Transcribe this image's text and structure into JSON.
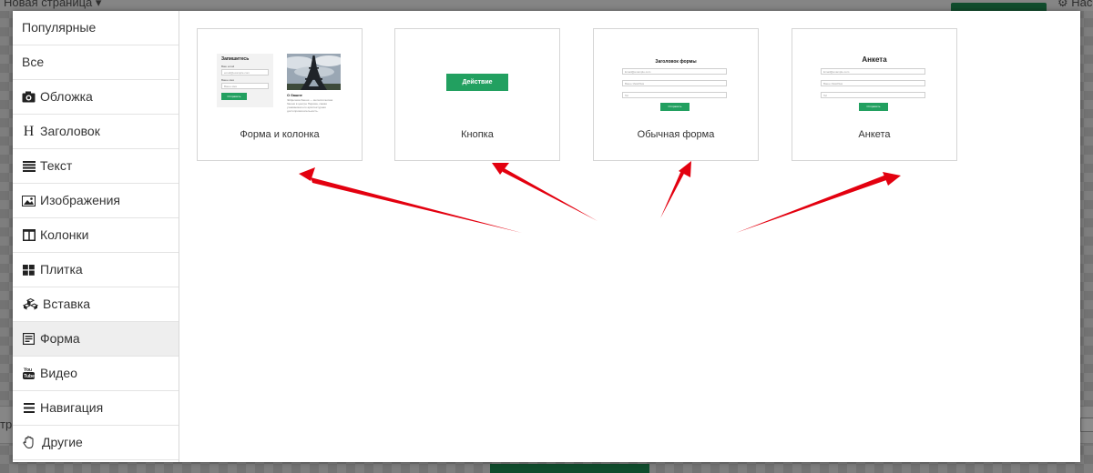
{
  "background": {
    "page_title": "Новая страница",
    "right_text": "Нас",
    "bottom_text": "тр"
  },
  "sidebar": {
    "items": [
      {
        "label": "Популярные",
        "icon": ""
      },
      {
        "label": "Все",
        "icon": ""
      },
      {
        "label": "Обложка",
        "icon": "camera-icon"
      },
      {
        "label": "Заголовок",
        "icon": "header-icon"
      },
      {
        "label": "Текст",
        "icon": "text-lines-icon"
      },
      {
        "label": "Изображения",
        "icon": "image-icon"
      },
      {
        "label": "Колонки",
        "icon": "columns-icon"
      },
      {
        "label": "Плитка",
        "icon": "tiles-icon"
      },
      {
        "label": "Вставка",
        "icon": "cubes-icon"
      },
      {
        "label": "Форма",
        "icon": "form-icon"
      },
      {
        "label": "Видео",
        "icon": "youtube-icon"
      },
      {
        "label": "Навигация",
        "icon": "hamburger-icon"
      },
      {
        "label": "Другие",
        "icon": "hand-icon"
      }
    ],
    "active": "Форма"
  },
  "cards": [
    {
      "label": "Форма и колонка",
      "thumb": {
        "form_title": "Запишитесь",
        "field1_label": "Ваш email",
        "field1_placeholder": "email@example.com",
        "field2_label": "Ваше имя",
        "field2_placeholder": "Ваше имя",
        "button": "Отправить",
        "caption": "О башне",
        "caption_text": "Эйфелева башня — металлическая башня в центре Парижа, самая узнаваемая его архитектурная достопримечательность."
      }
    },
    {
      "label": "Кнопка",
      "thumb": {
        "button": "Действие"
      }
    },
    {
      "label": "Обычная форма",
      "thumb": {
        "title": "Заголовок формы",
        "field1": "Email@example.com",
        "field2": "Ваше Имя/Имя",
        "field3": "Tel",
        "button": "Отправить"
      }
    },
    {
      "label": "Анкета",
      "thumb": {
        "title": "Анкета",
        "field1": "Email@example.com",
        "field2": "Ваше Имя/Имя",
        "field3": "Tel",
        "button": "Отправить"
      }
    }
  ],
  "colors": {
    "accent_green": "#22a060",
    "arrow_red": "#e3000f"
  }
}
